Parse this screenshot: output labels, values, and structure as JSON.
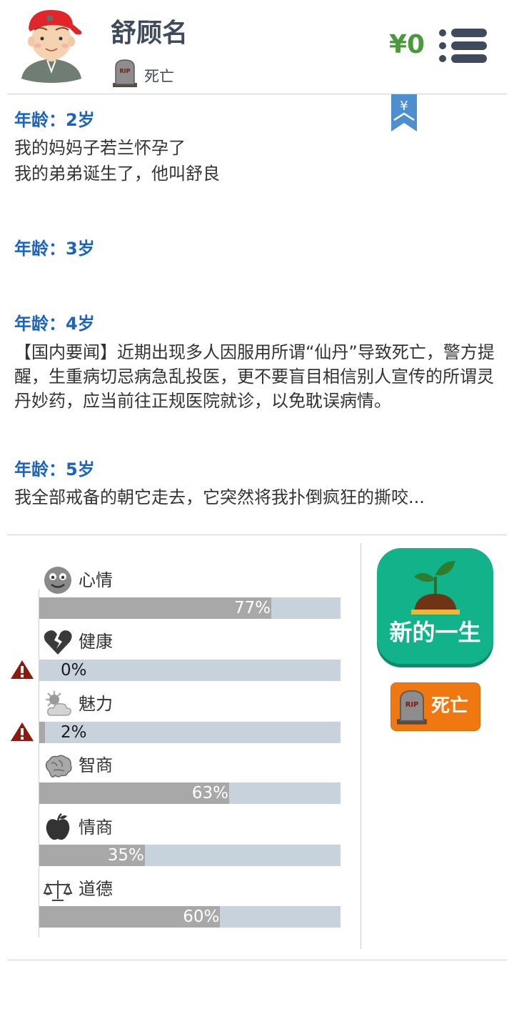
{
  "header": {
    "name": "舒顾名",
    "status": "死亡",
    "money": "¥0"
  },
  "bookmark": {
    "symbol": "¥"
  },
  "log": [
    {
      "age": "年龄：2岁",
      "lines": [
        "我的妈妈子若兰怀孕了",
        "我的弟弟诞生了，他叫舒良"
      ]
    },
    {
      "age": "年龄：3岁",
      "lines": []
    },
    {
      "age": "年龄：4岁",
      "lines": [
        "【国内要闻】近期出现多人因服用所谓“仙丹”导致死亡，警方提醒，生重病切忌病急乱投医，更不要盲目相信别人宣传的所谓灵丹妙药，应当前往正规医院就诊，以免耽误病情。"
      ]
    },
    {
      "age": "年龄：5岁",
      "lines": [
        "我全部戒备的朝它走去，它突然将我扑倒疯狂的撕咬..."
      ]
    }
  ],
  "stats": [
    {
      "label": "心情",
      "icon": "smiley-icon",
      "value": 77,
      "text": "77%",
      "warning": false
    },
    {
      "label": "健康",
      "icon": "broken-heart-icon",
      "value": 0,
      "text": "0%",
      "warning": true
    },
    {
      "label": "魅力",
      "icon": "sun-cloud-icon",
      "value": 2,
      "text": "2%",
      "warning": true
    },
    {
      "label": "智商",
      "icon": "brain-icon",
      "value": 63,
      "text": "63%",
      "warning": false
    },
    {
      "label": "情商",
      "icon": "apple-icon",
      "value": 35,
      "text": "35%",
      "warning": false
    },
    {
      "label": "道德",
      "icon": "scales-icon",
      "value": 60,
      "text": "60%",
      "warning": false
    }
  ],
  "buttons": {
    "new_life": "新的一生",
    "death": "死亡"
  },
  "colors": {
    "accent_blue": "#1a63c0",
    "money_green": "#4a9a3b",
    "bar_track": "#c8d2dc",
    "bar_fill": "#a8a8a8",
    "new_life_green": "#12b28a",
    "death_orange": "#f07810",
    "warning_red": "#8b1a10"
  }
}
